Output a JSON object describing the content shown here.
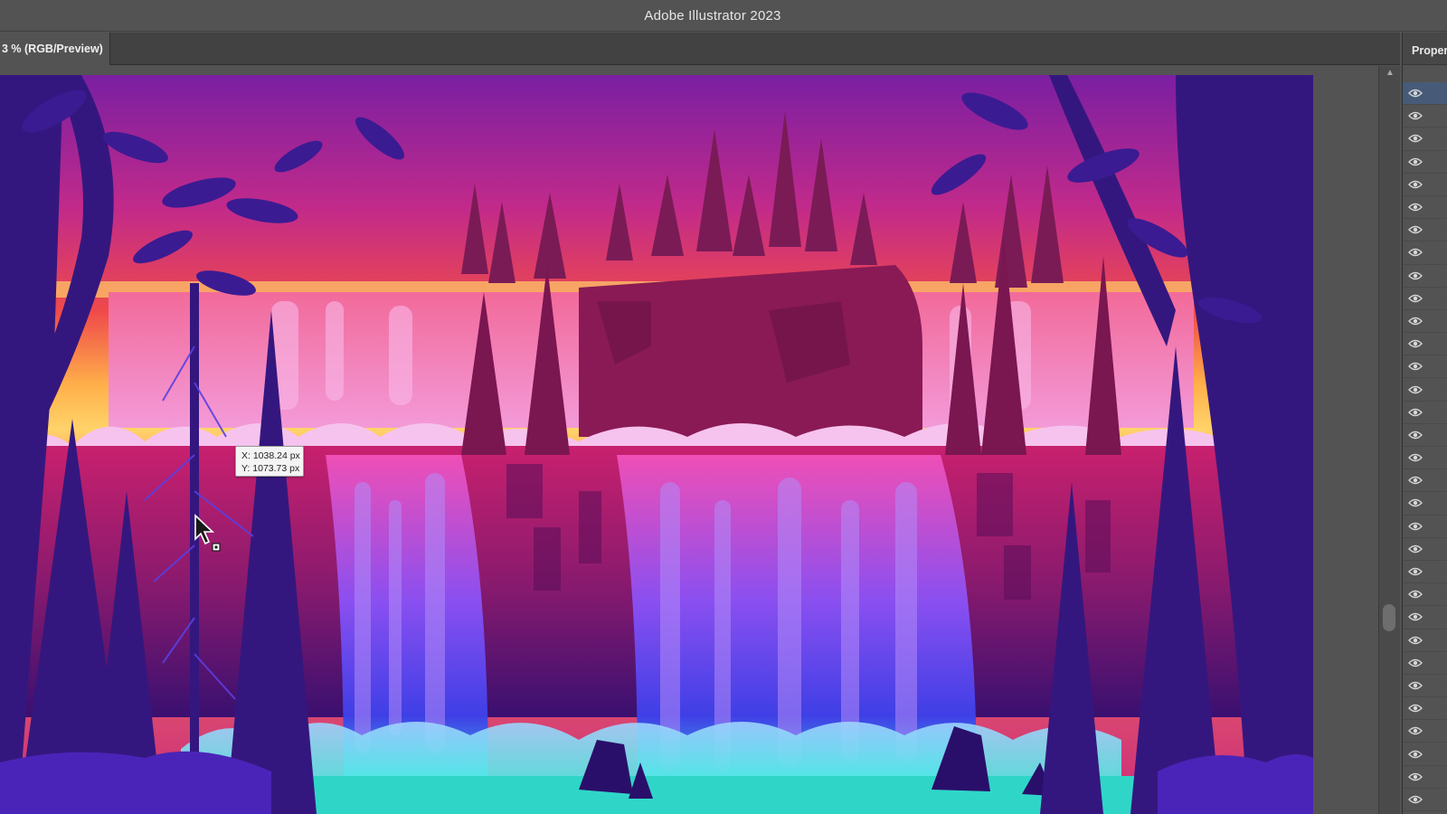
{
  "app": {
    "window_title": "Adobe Illustrator 2023"
  },
  "document_tab": {
    "label": "3 % (RGB/Preview)"
  },
  "right_panel": {
    "title": "Proper",
    "eye_rows": 32,
    "eye_icon": "eye-icon"
  },
  "cursor_readout": {
    "x_text": "X: 1038.24 px",
    "y_text": "Y: 1073.73 px"
  },
  "scrollbar": {
    "up_arrow_icon": "chevron-up-icon"
  },
  "colors": {
    "chrome": "#535353",
    "tab_strip": "#424242",
    "panel_selected": "#475b78",
    "sky_top": "#7a1fa2",
    "sky_mid": "#ef4a4a",
    "sky_glow": "#ffd36a",
    "waterfall": "#6a4cf0",
    "water": "#2fd6c8"
  }
}
